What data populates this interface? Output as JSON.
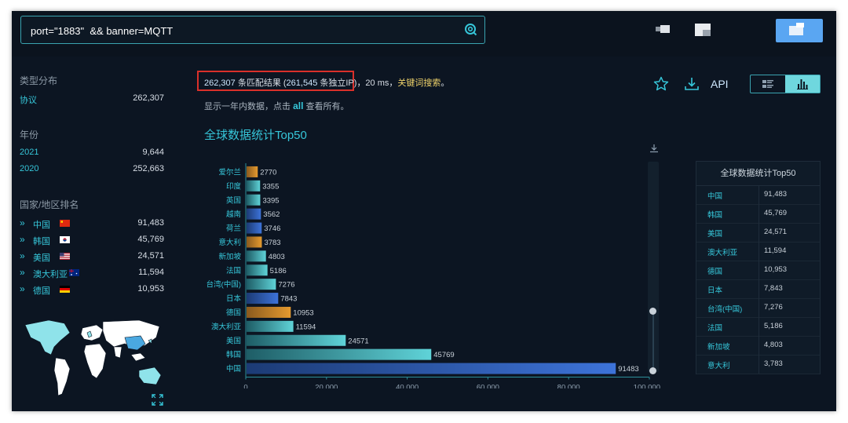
{
  "search": {
    "query": "port=\"1883\"  && banner=MQTT"
  },
  "sidebar": {
    "type_title": "类型分布",
    "types": [
      {
        "label": "协议",
        "value": "262,307"
      }
    ],
    "year_title": "年份",
    "years": [
      {
        "label": "2021",
        "value": "9,644"
      },
      {
        "label": "2020",
        "value": "252,663"
      }
    ],
    "country_title": "国家/地区排名",
    "countries": [
      {
        "label": "中国",
        "value": "91,483",
        "flag": "cn"
      },
      {
        "label": "韩国",
        "value": "45,769",
        "flag": "kr"
      },
      {
        "label": "美国",
        "value": "24,571",
        "flag": "us"
      },
      {
        "label": "澳大利亚",
        "value": "11,594",
        "flag": "au"
      },
      {
        "label": "德国",
        "value": "10,953",
        "flag": "de"
      }
    ]
  },
  "results": {
    "count": "262,307",
    "count_suffix": " 条匹配结果 (",
    "ips": "261,545",
    "ips_suffix": " 条独立IP)",
    "time": "，20 ms，",
    "keyword_search": "关键词搜索",
    "end": "。",
    "sub_prefix": "显示一年内数据，点击 ",
    "sub_all": "all",
    "sub_suffix": " 查看所有。"
  },
  "toolbar": {
    "api_label": "API"
  },
  "chart_data": {
    "type": "bar",
    "orientation": "horizontal",
    "title": "全球数据统计Top50",
    "categories": [
      "爱尔兰",
      "印度",
      "英国",
      "越南",
      "荷兰",
      "意大利",
      "新加坡",
      "法国",
      "台湾(中国)",
      "日本",
      "德国",
      "澳大利亚",
      "美国",
      "韩国",
      "中国"
    ],
    "values": [
      2770,
      3355,
      3395,
      3562,
      3746,
      3783,
      4803,
      5186,
      7276,
      7843,
      10953,
      11594,
      24571,
      45769,
      91483
    ],
    "xticks": [
      "0",
      "20,000",
      "40,000",
      "60,000",
      "80,000",
      "100,000"
    ],
    "xlim": [
      0,
      100000
    ],
    "grid": false,
    "colors": {
      "orange": "#e59a2f",
      "teal": "#5fd3d8",
      "blue": "#3d73d9"
    }
  },
  "table": {
    "title": "全球数据统计Top50",
    "rows": [
      {
        "country": "中国",
        "value": "91,483"
      },
      {
        "country": "韩国",
        "value": "45,769"
      },
      {
        "country": "美国",
        "value": "24,571"
      },
      {
        "country": "澳大利亚",
        "value": "11,594"
      },
      {
        "country": "德国",
        "value": "10,953"
      },
      {
        "country": "日本",
        "value": "7,843"
      },
      {
        "country": "台湾(中国)",
        "value": "7,276"
      },
      {
        "country": "法国",
        "value": "5,186"
      },
      {
        "country": "新加坡",
        "value": "4,803"
      },
      {
        "country": "意大利",
        "value": "3,783"
      }
    ]
  },
  "colors": {
    "accent": "#36c6d9",
    "background": "#0c1522",
    "highlight_box": "#d9302a",
    "login": "#5aa6f2"
  }
}
